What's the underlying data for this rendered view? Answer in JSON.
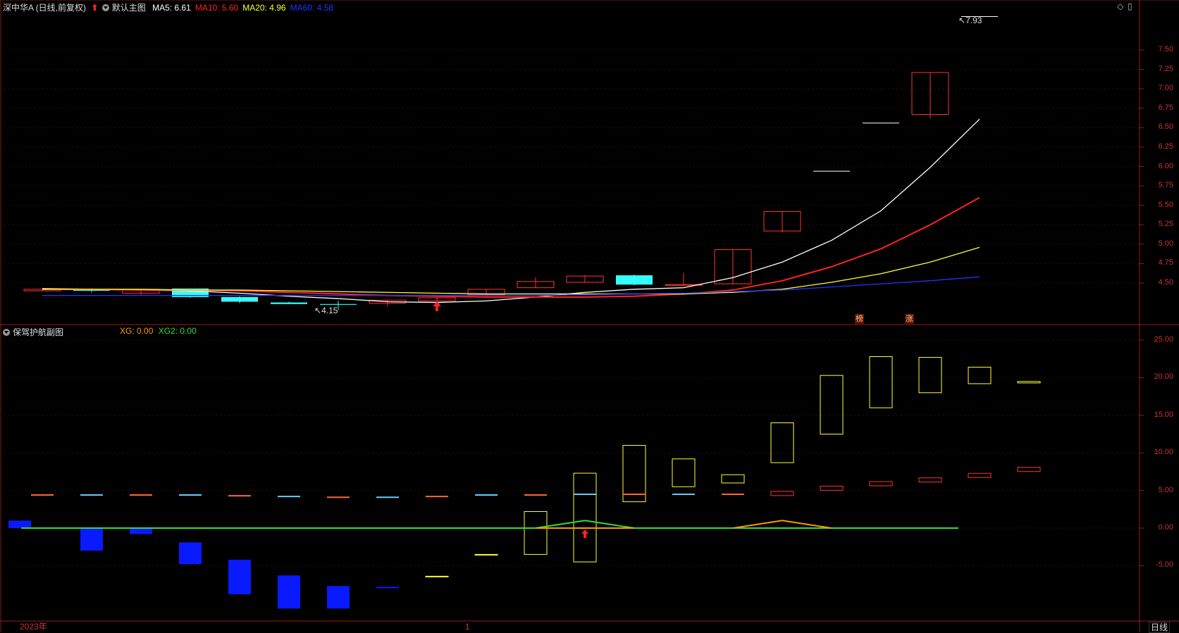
{
  "header": {
    "stock_name": "深中华A",
    "period_mode": "(日线,前复权)",
    "main_chart_name": "默认主图",
    "ma": [
      {
        "label": "MA5:",
        "value": "6.61",
        "color": "#ffffff"
      },
      {
        "label": "MA10:",
        "value": "5.60",
        "color": "#ff2222"
      },
      {
        "label": "MA20:",
        "value": "4.96",
        "color": "#ffff33"
      },
      {
        "label": "MA60:",
        "value": "4.58",
        "color": "#2233ff"
      }
    ]
  },
  "sub_header": {
    "indicator_name": "保驾护航副图",
    "xg_label": "XG:",
    "xg_value": "0.00",
    "xg_color": "#ff9900",
    "xg2_label": "XG2:",
    "xg2_value": "0.00",
    "xg2_color": "#33dd33"
  },
  "annotations": {
    "high_label": "7.93",
    "low_label": "4.15",
    "badge_1": "榜",
    "badge_2": "涨"
  },
  "x_axis": {
    "year_label": "2023年",
    "month_label": "1",
    "period_button": "日线"
  },
  "chart_data": [
    {
      "type": "candlestick",
      "title": "深中华A (日线,前复权)",
      "ylim": [
        4.15,
        7.93
      ],
      "y_ticks": [
        "7.50",
        "7.25",
        "7.00",
        "6.75",
        "6.50",
        "6.25",
        "6.00",
        "5.75",
        "5.50",
        "5.25",
        "5.00",
        "4.75",
        "4.50"
      ],
      "candles": [
        {
          "o": 4.4,
          "c": 4.42,
          "h": 4.42,
          "l": 4.4,
          "col": "red"
        },
        {
          "o": 4.4,
          "c": 4.41,
          "h": 4.43,
          "l": 4.38,
          "col": "cyan"
        },
        {
          "o": 4.37,
          "c": 4.42,
          "h": 4.42,
          "l": 4.35,
          "col": "red"
        },
        {
          "o": 4.43,
          "c": 4.32,
          "h": 4.43,
          "l": 4.31,
          "col": "cyan"
        },
        {
          "o": 4.32,
          "c": 4.26,
          "h": 4.33,
          "l": 4.24,
          "col": "cyan"
        },
        {
          "o": 4.25,
          "c": 4.23,
          "h": 4.26,
          "l": 4.23,
          "col": "cyan"
        },
        {
          "o": 4.23,
          "c": 4.22,
          "h": 4.27,
          "l": 4.15,
          "col": "cyan"
        },
        {
          "o": 4.24,
          "c": 4.28,
          "h": 4.29,
          "l": 4.2,
          "col": "red"
        },
        {
          "o": 4.27,
          "c": 4.31,
          "h": 4.33,
          "l": 4.25,
          "col": "red"
        },
        {
          "o": 4.35,
          "c": 4.42,
          "h": 4.42,
          "l": 4.33,
          "col": "red"
        },
        {
          "o": 4.44,
          "c": 4.52,
          "h": 4.57,
          "l": 4.44,
          "col": "red"
        },
        {
          "o": 4.51,
          "c": 4.59,
          "h": 4.6,
          "l": 4.51,
          "col": "red"
        },
        {
          "o": 4.6,
          "c": 4.48,
          "h": 4.61,
          "l": 4.47,
          "col": "cyan"
        },
        {
          "o": 4.48,
          "c": 4.48,
          "h": 4.63,
          "l": 4.48,
          "col": "red"
        },
        {
          "o": 4.49,
          "c": 4.93,
          "h": 4.93,
          "l": 4.49,
          "col": "red"
        },
        {
          "o": 5.17,
          "c": 5.42,
          "h": 5.42,
          "l": 5.15,
          "col": "red"
        },
        {
          "o": 5.94,
          "c": 5.94,
          "h": 5.94,
          "l": 5.94,
          "col": "white"
        },
        {
          "o": 6.56,
          "c": 6.56,
          "h": 6.56,
          "l": 6.56,
          "col": "white"
        },
        {
          "o": 6.67,
          "c": 7.21,
          "h": 7.21,
          "l": 6.62,
          "col": "red"
        },
        {
          "o": 7.93,
          "c": 7.93,
          "h": 7.93,
          "l": 7.93,
          "col": "white"
        }
      ],
      "series": [
        {
          "name": "MA5",
          "color": "#ffffff",
          "values": [
            4.43,
            4.42,
            4.41,
            4.4,
            4.37,
            4.33,
            4.3,
            4.26,
            4.25,
            4.27,
            4.32,
            4.38,
            4.42,
            4.44,
            4.57,
            4.77,
            5.05,
            5.43,
            5.99,
            6.61
          ]
        },
        {
          "name": "MA10",
          "color": "#ff2222",
          "values": [
            4.42,
            4.42,
            4.41,
            4.41,
            4.4,
            4.38,
            4.36,
            4.34,
            4.33,
            4.32,
            4.32,
            4.32,
            4.33,
            4.36,
            4.41,
            4.53,
            4.71,
            4.94,
            5.25,
            5.6
          ]
        },
        {
          "name": "MA20",
          "color": "#ffff33",
          "values": [
            4.42,
            4.42,
            4.42,
            4.41,
            4.41,
            4.4,
            4.39,
            4.38,
            4.37,
            4.36,
            4.36,
            4.36,
            4.36,
            4.36,
            4.38,
            4.42,
            4.51,
            4.62,
            4.77,
            4.96
          ]
        },
        {
          "name": "MA60",
          "color": "#2233ff",
          "values": [
            4.34,
            4.34,
            4.34,
            4.34,
            4.34,
            4.34,
            4.34,
            4.34,
            4.34,
            4.34,
            4.34,
            4.35,
            4.36,
            4.37,
            4.39,
            4.41,
            4.45,
            4.49,
            4.53,
            4.58
          ]
        }
      ],
      "signal_arrow_index": 8
    },
    {
      "type": "bar",
      "title": "保驾护航副图",
      "ylim": [
        -10,
        25
      ],
      "y_ticks": [
        "25.00",
        "20.00",
        "15.00",
        "10.00",
        "5.00",
        "0.00",
        "-5.00"
      ],
      "bars": [
        1.0,
        -3.0,
        -0.8,
        -4.8,
        -8.8,
        -10.7,
        -10.7,
        -8.0,
        -6.4,
        -3.5,
        2.2,
        7.3,
        11.0,
        9.2,
        7.1,
        14.0,
        20.3,
        22.8,
        22.7,
        21.4,
        19.5
      ],
      "bars_low": [
        0,
        0,
        0,
        -1.9,
        -4.2,
        -6.3,
        -7.7,
        -7.8,
        -3.5,
        -2.2,
        -3.5,
        -4.5,
        3.5,
        5.5,
        6.0,
        8.7,
        12.5,
        16.0,
        18.0,
        19.2,
        19.3
      ],
      "lines": [
        4.4,
        4.4,
        4.4,
        4.4,
        4.3,
        4.2,
        4.1,
        4.1,
        4.2,
        4.4,
        4.4,
        4.5,
        4.5,
        4.5,
        4.5,
        4.6,
        5.3,
        5.9,
        6.4,
        7.0,
        7.8
      ],
      "xg": [
        0,
        0,
        0,
        0,
        0,
        0,
        0,
        0,
        0,
        0,
        0,
        0,
        0,
        0,
        0,
        1,
        0,
        0,
        0,
        0,
        0
      ],
      "xg2": [
        0,
        0,
        0,
        0,
        0,
        0,
        0,
        0,
        0,
        0,
        0,
        1,
        0,
        0,
        0,
        0,
        0,
        0,
        0,
        0,
        0
      ],
      "arrow_index": 11
    }
  ]
}
